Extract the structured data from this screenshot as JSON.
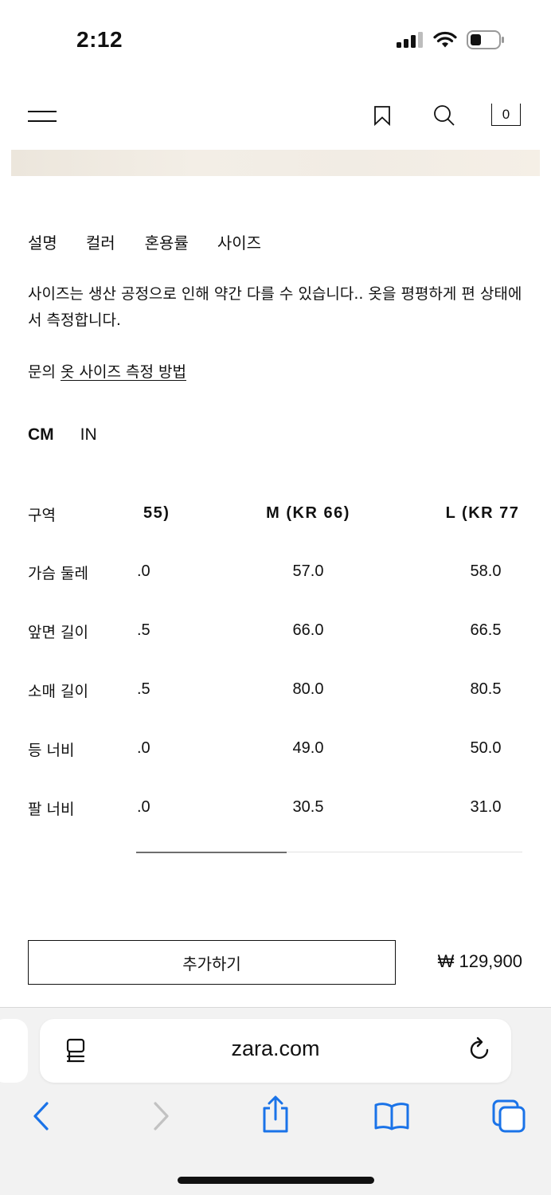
{
  "status_bar": {
    "time": "2:12"
  },
  "header": {
    "bag_count": "0"
  },
  "tabs": [
    "설명",
    "컬러",
    "혼용률",
    "사이즈"
  ],
  "description": "사이즈는 생산 공정으로 인해 약간 다를 수 있습니다.. 옷을 평평하게 편 상태에서 측정합니다.",
  "guide": {
    "prefix": "문의",
    "link_label": "옷 사이즈 측정 방법"
  },
  "units": {
    "cm": "CM",
    "in": "IN"
  },
  "size_table": {
    "corner_label": "구역",
    "columns": [
      "55)",
      "M (KR 66)",
      "L (KR 77"
    ],
    "rows": [
      {
        "label": "가슴 둘레",
        "values": [
          ".0",
          "57.0",
          "58.0"
        ]
      },
      {
        "label": "앞면 길이",
        "values": [
          ".5",
          "66.0",
          "66.5"
        ]
      },
      {
        "label": "소매 길이",
        "values": [
          ".5",
          "80.0",
          "80.5"
        ]
      },
      {
        "label": "등 너비",
        "values": [
          ".0",
          "49.0",
          "50.0"
        ]
      },
      {
        "label": "팔 너비",
        "values": [
          ".0",
          "30.5",
          "31.0"
        ]
      }
    ]
  },
  "purchase": {
    "add_label": "추가하기",
    "price": "₩ 129,900"
  },
  "browser": {
    "url": "zara.com"
  },
  "colors": {
    "accent_blue": "#1a73e8",
    "text": "#111111"
  }
}
